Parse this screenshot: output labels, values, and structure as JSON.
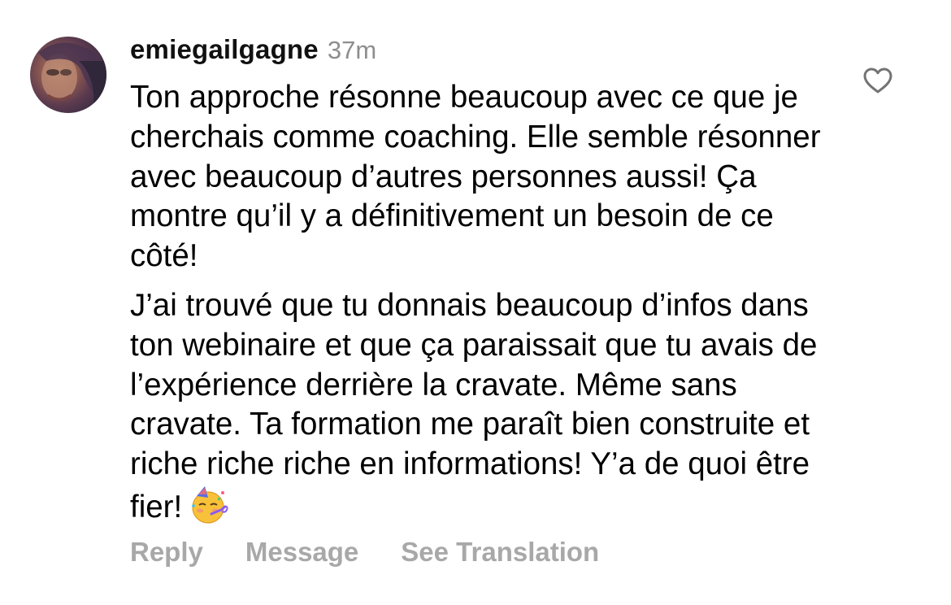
{
  "comment": {
    "username": "emiegailgagne",
    "time_ago": "37m",
    "paragraphs": [
      "Ton approche résonne beaucoup avec ce que je cherchais comme coaching. Elle semble résonner avec beaucoup d’autres personnes aussi! Ça montre qu’il y a définitivement un besoin de ce côté!",
      "J’ai trouvé que tu donnais beaucoup d’infos dans ton webinaire et que ça paraissait que tu avais de l’expérience derrière la cravate. Même sans cravate. Ta formation me paraît bien construite et riche riche riche en informations! Y’a de quoi être fier!"
    ],
    "emoji": "partying-face-emoji",
    "like_icon": "heart-outline-icon",
    "avatar": "user-avatar"
  },
  "actions": {
    "reply_label": "Reply",
    "message_label": "Message",
    "translation_label": "See Translation"
  },
  "colors": {
    "text": "#000000",
    "username": "#111111",
    "muted_time": "#8e8e8e",
    "action_gray": "#a8a8a8"
  }
}
